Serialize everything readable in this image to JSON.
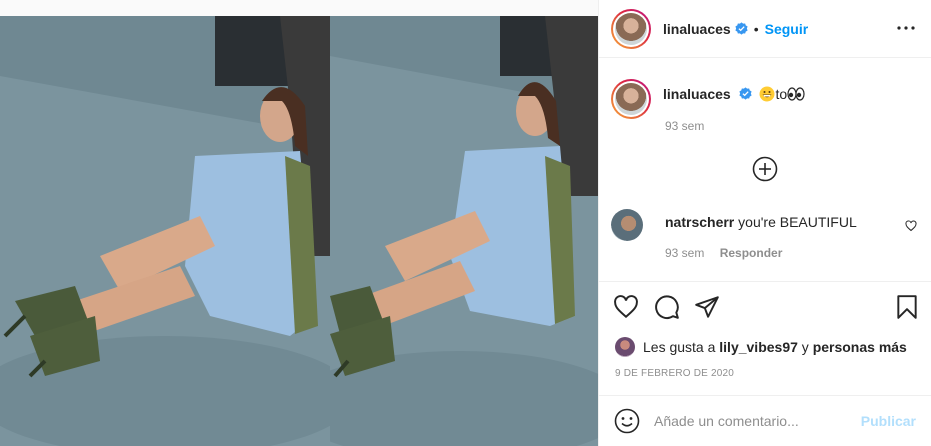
{
  "post": {
    "username": "linaluaces",
    "follow_label": "Seguir",
    "separator": "•",
    "more_label": "•••"
  },
  "caption": {
    "username": "linaluaces",
    "text": "to",
    "emojis": [
      "grinning-face-emoji",
      "eyes-emoji"
    ],
    "time": "93 sem"
  },
  "comment": {
    "username": "natrscherr",
    "text": "you're BEAUTIFUL",
    "time": "93 sem",
    "reply_label": "Responder"
  },
  "likes": {
    "prefix": "Les gusta a",
    "user": "lily_vibes97",
    "conjunction": "y",
    "others": "personas más"
  },
  "date": "9 DE FEBRERO DE 2020",
  "add_comment": {
    "placeholder": "Añade un comentario...",
    "publish_label": "Publicar"
  },
  "icons": {
    "heart": "heart-icon",
    "comment": "comment-icon",
    "share": "share-icon",
    "save": "bookmark-icon",
    "load_more": "plus-circle-icon",
    "emoji": "smiley-icon",
    "verified": "verified-badge-icon",
    "more": "more-options-icon"
  },
  "colors": {
    "link_blue": "#0095f6",
    "publish_disabled": "#b2dffc",
    "muted_text": "#8e8e8e",
    "verified": "#3897f0"
  }
}
